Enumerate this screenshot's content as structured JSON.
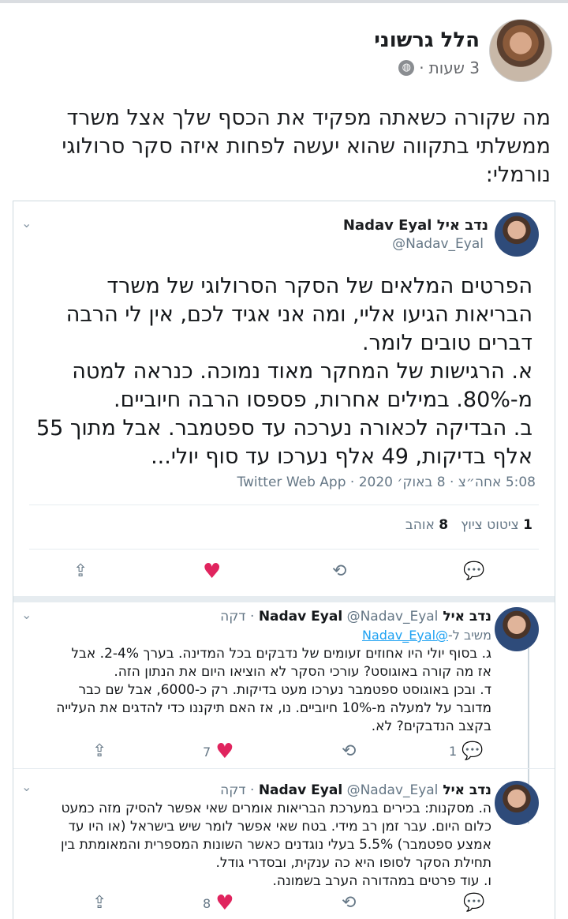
{
  "post": {
    "author": "הלל גרשוני",
    "time": "3 שעות",
    "dot": "·",
    "privacy_icon": "globe-icon",
    "text": "מה שקורה כשאתה מפקיד את הכסף שלך אצל משרד ממשלתי בתקווה שהוא יעשה לפחות איזה סקר סרולוגי נורמלי:"
  },
  "tweet": {
    "name": "נדב איל Nadav Eyal",
    "handle": "@Nadav_Eyal",
    "lines": [
      "הפרטים המלאים של הסקר הסרולוגי של משרד",
      "הבריאות הגיעו אליי, ומה אני אגיד לכם, אין לי הרבה",
      "דברים טובים לומר.",
      "א. הרגישות של המחקר מאוד נמוכה. כנראה למטה",
      "מ-80%. במילים אחרות, פספסו הרבה חיוביים.",
      "ב. הבדיקה לכאורה נערכה עד ספטמבר. אבל מתוך 55",
      "אלף בדיקות, 49 אלף נערכו עד סוף יולי..."
    ],
    "date": "5:08 אחה״צ · 8 באוק׳ 2020 · Twitter Web App",
    "retweets_count": "1",
    "retweets_label": "ציטוט ציוץ",
    "likes_count": "8",
    "likes_label": "אוהב"
  },
  "replies": [
    {
      "name": "נדב איל Nadav Eyal",
      "handle": "@Nadav_Eyal",
      "time": "· דקה",
      "replying_prefix": "משיב ל-",
      "replying_handle": "@Nadav_Eyal",
      "lines": [
        "ג. בסוף יולי היו אחוזים זעומים של נדבקים בכל המדינה. בערך 2-4%. אבל",
        "אז מה קורה באוגוסט? עורכי הסקר לא הוציאו היום את הנתון הזה.",
        "ד. ובכן באוגוסט ספטמבר נערכו מעט בדיקות. רק כ-6000, אבל שם כבר",
        "מדובר על למעלה מ-10% חיוביים. נו, אז האם תיקננו כדי להדגים את העלייה",
        "בקצב הנדבקים? לא."
      ],
      "reply_count": "1",
      "like_count": "7"
    },
    {
      "name": "נדב איל Nadav Eyal",
      "handle": "@Nadav_Eyal",
      "time": "· דקה",
      "lines": [
        "ה. מסקנות: בכירים במערכת הבריאות אומרים שאי אפשר להסיק מזה כמעט",
        "כלום היום. עבר זמן רב מידי. בטח שאי אפשר לומר שיש בישראל (או היו עד",
        "אמצע ספטמבר) 5.5% בעלי נוגדנים כאשר השונות המספרית והמאומתת בין",
        "תחילת הסקר לסופו היא כה ענקית, ובסדרי גודל.",
        "ו. עוד פרטים במהדורה הערב בשמונה."
      ],
      "like_count": "8"
    }
  ],
  "colors": {
    "heart": "#e0245e",
    "link": "#1da1f2",
    "muted": "#657786"
  }
}
